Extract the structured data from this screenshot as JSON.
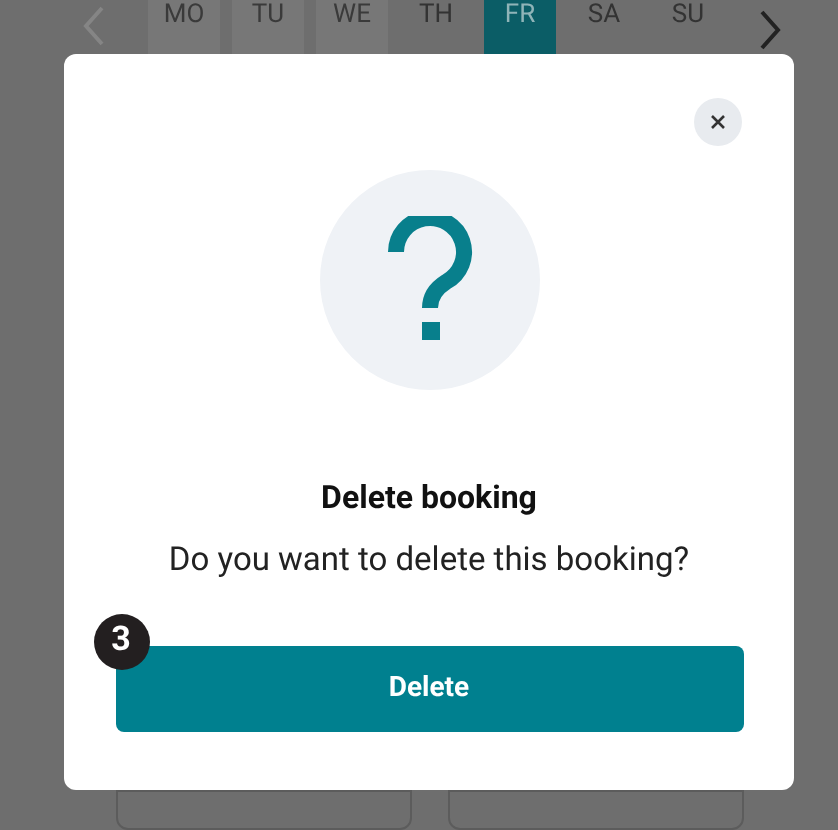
{
  "week_strip": {
    "prev_disabled": true,
    "days": [
      {
        "label": "MO",
        "selected": false
      },
      {
        "label": "TU",
        "selected": false
      },
      {
        "label": "WE",
        "selected": false
      },
      {
        "label": "TH",
        "selected": false
      },
      {
        "label": "FR",
        "selected": true
      },
      {
        "label": "SA",
        "selected": false
      },
      {
        "label": "SU",
        "selected": false
      }
    ]
  },
  "dialog": {
    "title": "Delete booking",
    "message": "Do you want to delete this booking?",
    "step_badge": "3",
    "confirm_button": "Delete"
  }
}
